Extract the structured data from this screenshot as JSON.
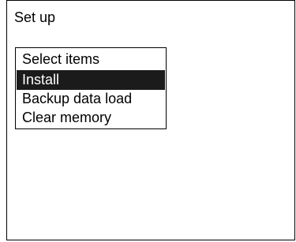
{
  "screen": {
    "title": "Set up"
  },
  "menu": {
    "header": "Select items",
    "items": [
      {
        "label": "Install",
        "selected": true
      },
      {
        "label": "Backup data load",
        "selected": false
      },
      {
        "label": "Clear memory",
        "selected": false
      }
    ],
    "colors": {
      "selected_background": "#1b1b1b",
      "selected_text": "#ffffff",
      "text": "#000000",
      "border": "#000000"
    }
  }
}
